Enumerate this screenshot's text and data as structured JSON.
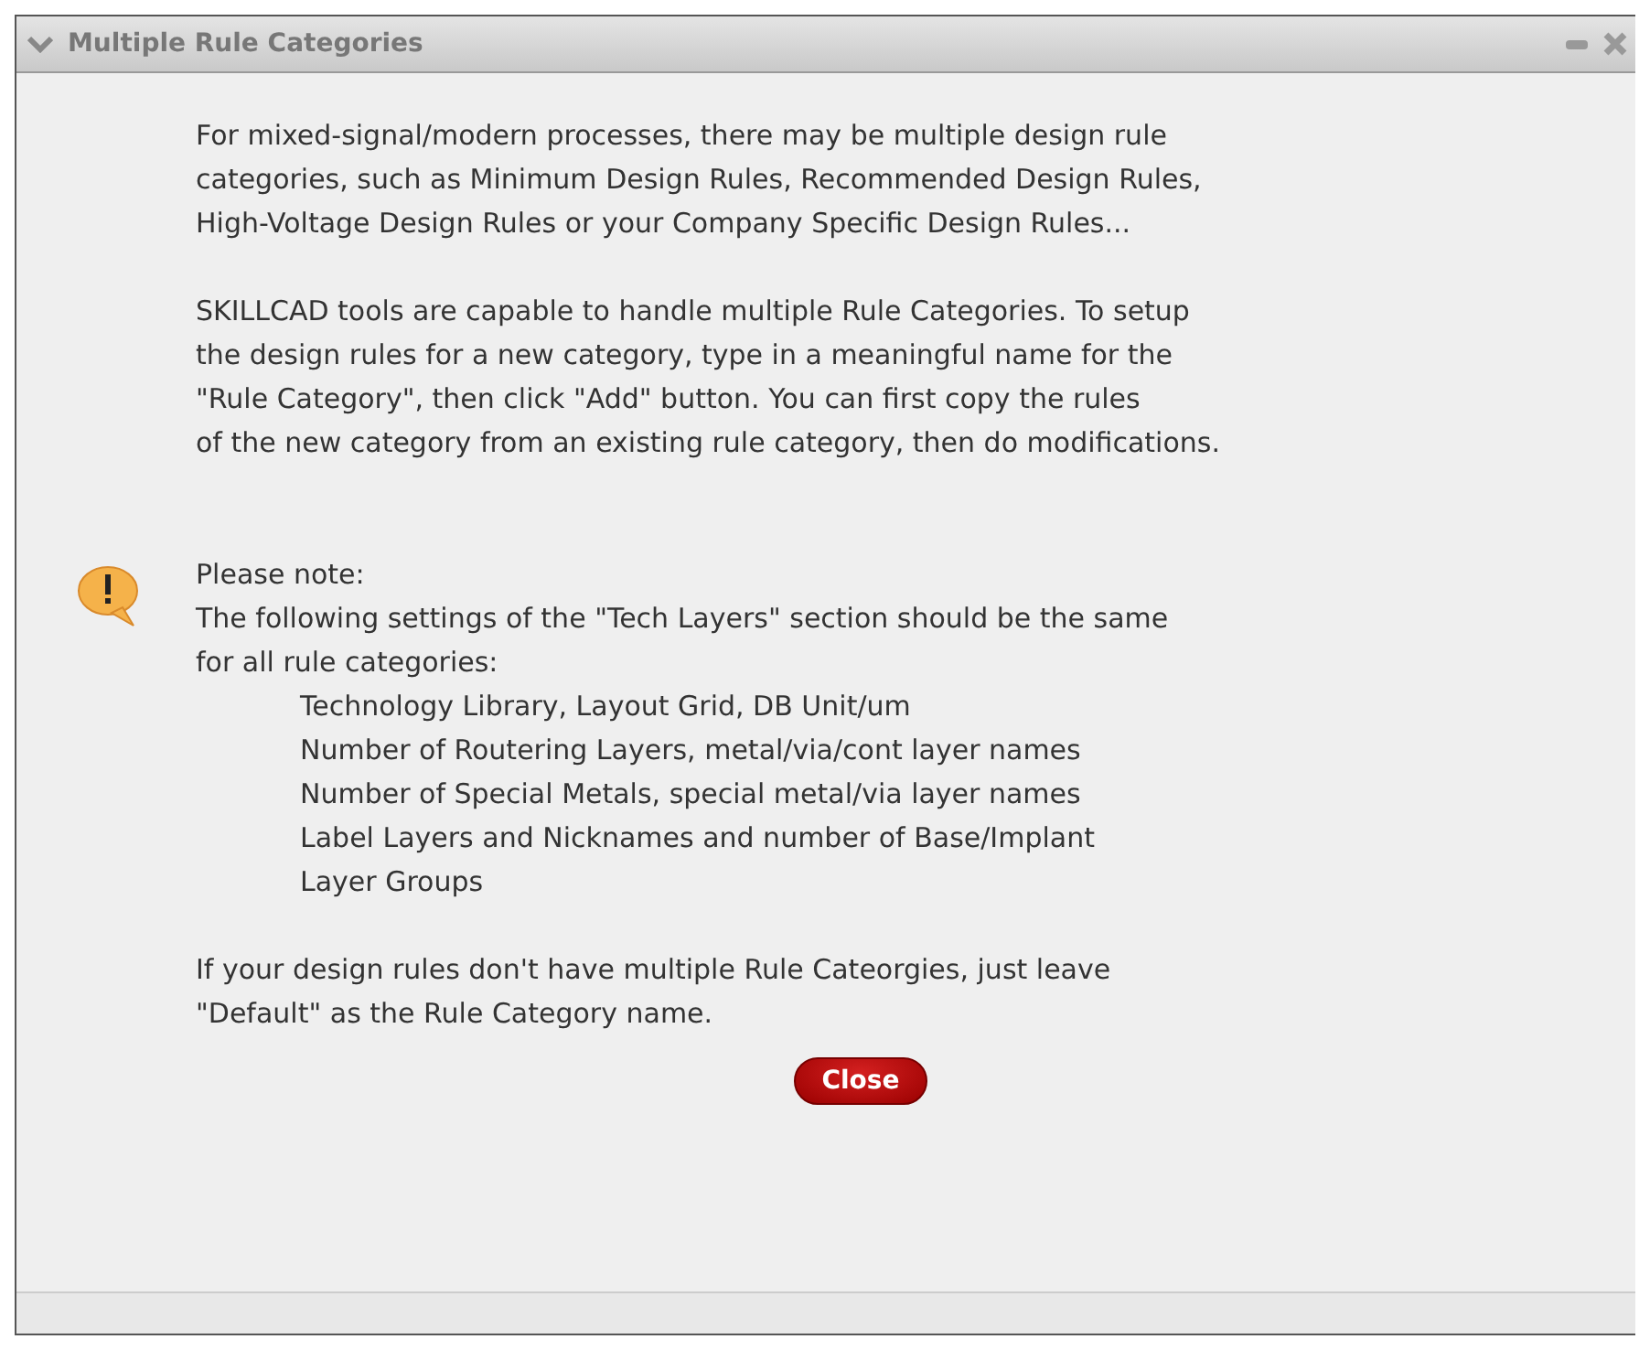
{
  "window": {
    "title": "Multiple Rule Categories"
  },
  "paragraphs": [
    [
      "For mixed-signal/modern processes, there may be multiple design rule",
      "categories, such as Minimum Design Rules, Recommended Design Rules,",
      "High-Voltage Design Rules or your Company Specific Design Rules..."
    ],
    [
      "SKILLCAD tools are capable to handle multiple Rule Categories. To setup",
      "the design rules for a new category, type in a meaningful name for the",
      "\"Rule Category\", then click \"Add\" button. You can first copy the rules",
      "of the new category from an existing rule category, then do modifications."
    ]
  ],
  "note": {
    "heading": "Please note:",
    "text": [
      "The following settings of the \"Tech Layers\" section should be the same",
      "for all rule categories:"
    ],
    "items": [
      [
        "Technology Library, Layout Grid, DB Unit/um"
      ],
      [
        "Number of Routering Layers, metal/via/cont layer names"
      ],
      [
        "Number of Special Metals, special metal/via layer names"
      ],
      [
        "Label Layers and Nicknames and number of Base/Implant",
        "Layer Groups"
      ]
    ]
  },
  "footer": [
    "If your design rules don't have multiple Rule Cateorgies, just leave",
    "\"Default\" as the Rule Category name."
  ],
  "close_button": "Close"
}
